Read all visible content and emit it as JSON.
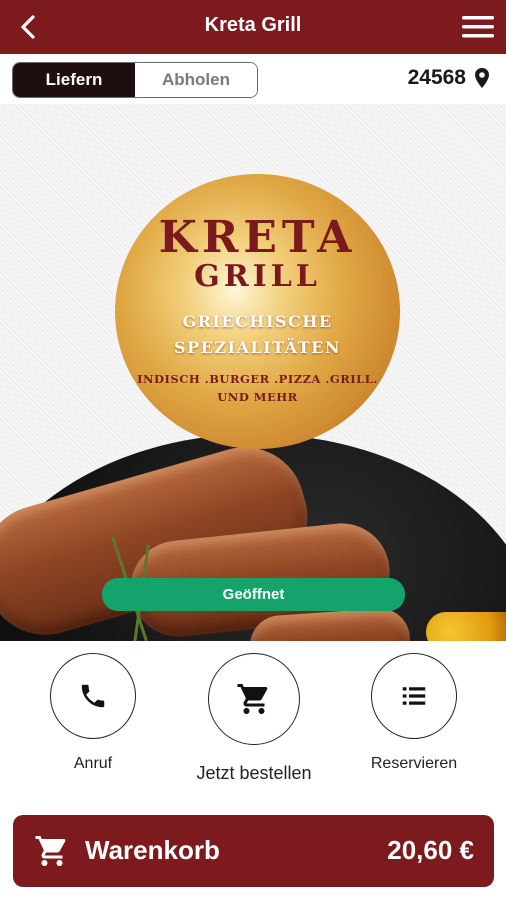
{
  "header": {
    "title": "Kreta Grill",
    "back_icon": "chevron-left-icon",
    "menu_icon": "hamburger-menu-icon"
  },
  "mode": {
    "options": [
      "Liefern",
      "Abholen"
    ],
    "selected": "Liefern"
  },
  "location": {
    "postal_code": "24568",
    "icon": "map-pin-icon"
  },
  "logo": {
    "line1": "KRETA",
    "line2": "GRILL",
    "line3": "GRIECHISCHE SPEZIALITÄTEN",
    "line4": "INDISCH .BURGER .PIZZA .GRILL. UND MEHR"
  },
  "status": {
    "label": "Geöffnet",
    "color": "#14a36c"
  },
  "actions": [
    {
      "label": "Anruf",
      "icon": "phone-icon"
    },
    {
      "label": "Jetzt bestellen",
      "icon": "shopping-cart-icon"
    },
    {
      "label": "Reservieren",
      "icon": "list-icon"
    }
  ],
  "cart": {
    "label": "Warenkorb",
    "total": "20,60 €",
    "icon": "shopping-cart-icon"
  },
  "colors": {
    "brand": "#7d1a1d",
    "toggle_active": "#1e0e0f",
    "open_status": "#14a36c"
  }
}
